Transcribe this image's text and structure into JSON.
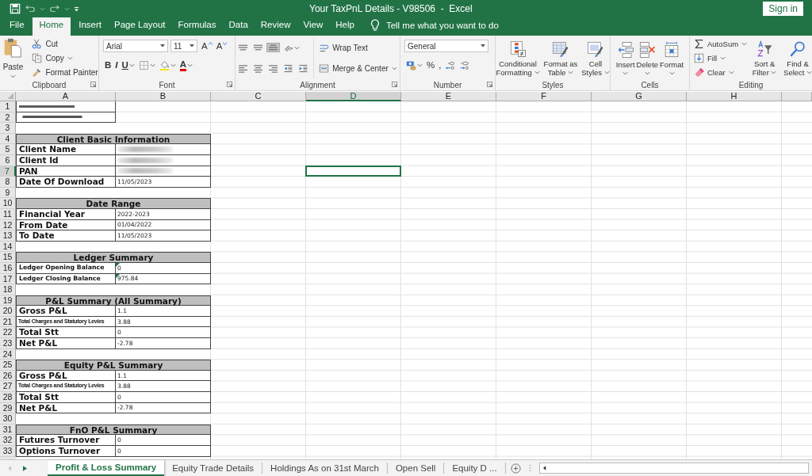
{
  "title_bar": {
    "title": "Your TaxPnL Details - V98506  -  Excel",
    "sign_in": "Sign in"
  },
  "menu_tabs": [
    {
      "label": "File",
      "selected": false
    },
    {
      "label": "Home",
      "selected": true
    },
    {
      "label": "Insert",
      "selected": false
    },
    {
      "label": "Page Layout",
      "selected": false
    },
    {
      "label": "Formulas",
      "selected": false
    },
    {
      "label": "Data",
      "selected": false
    },
    {
      "label": "Review",
      "selected": false
    },
    {
      "label": "View",
      "selected": false
    },
    {
      "label": "Help",
      "selected": false
    }
  ],
  "tell_me": "Tell me what you want to do",
  "ribbon": {
    "groups": [
      {
        "label": "Clipboard",
        "launcher": true,
        "sections": [
          [
            [
              {
                "kind": "large",
                "label": "Paste",
                "dropdown": true
              }
            ]
          ],
          [
            [
              {
                "kind": "small",
                "label": "Cut",
                "dropdown": false
              }
            ],
            [
              {
                "kind": "small",
                "label": "Copy",
                "dropdown": true
              }
            ],
            [
              {
                "kind": "small",
                "label": "Format Painter",
                "dropdown": false
              }
            ]
          ]
        ]
      },
      {
        "label": "Font",
        "launcher": true,
        "sections": [
          [
            [
              {
                "kind": "field",
                "value": "Arial"
              },
              {
                "kind": "size",
                "value": "11"
              },
              {
                "kind": "grow",
                "label": "A"
              },
              {
                "kind": "shrink",
                "label": "A"
              }
            ],
            [
              {
                "kind": "bold",
                "label": "B",
                "dropdown": false
              },
              {
                "kind": "italic",
                "label": "I",
                "dropdown": false
              },
              {
                "kind": "underline",
                "label": "U",
                "dropdown": true
              },
              {
                "kind": "icon",
                "dropdown": true
              },
              {
                "kind": "icon",
                "dropdown": true
              },
              {
                "kind": "fontcolor",
                "label": "A",
                "dropdown": true,
                "color": "#e00000"
              }
            ]
          ]
        ]
      },
      {
        "label": "Alignment",
        "launcher": true,
        "sections": [
          [
            [
              {
                "kind": "icon",
                "selected": false,
                "dropdown": false
              },
              {
                "kind": "icon",
                "selected": false,
                "dropdown": false
              },
              {
                "kind": "icon",
                "selected": true,
                "dropdown": false
              },
              {
                "kind": "icon",
                "selected": false,
                "dropdown": true
              }
            ],
            [
              {
                "kind": "icon",
                "dropdown": false
              },
              {
                "kind": "icon",
                "dropdown": false
              },
              {
                "kind": "icon",
                "dropdown": false
              },
              {
                "kind": "icon",
                "dropdown": false
              },
              {
                "kind": "icon",
                "dropdown": false
              }
            ]
          ],
          [
            [
              {
                "kind": "small",
                "label": "Wrap Text",
                "dropdown": false
              }
            ],
            [
              {
                "kind": "small",
                "label": "Merge & Center",
                "dropdown": true
              }
            ]
          ]
        ]
      },
      {
        "label": "Number",
        "launcher": true,
        "sections": [
          [
            [
              {
                "kind": "field",
                "value": "General"
              }
            ],
            [
              {
                "kind": "icon",
                "dropdown": true
              },
              {
                "kind": "percent",
                "label": "%",
                "dropdown": false
              },
              {
                "kind": "comma",
                "label": ",",
                "dropdown": false
              },
              {
                "kind": "icon",
                "dropdown": false
              },
              {
                "kind": "icon",
                "dropdown": false
              }
            ]
          ]
        ]
      },
      {
        "label": "Styles",
        "launcher": false,
        "sections": [
          [
            [
              {
                "kind": "large",
                "label": "Conditional Formatting",
                "dropdown": true
              }
            ]
          ],
          [
            [
              {
                "kind": "large",
                "label": "Format as Table",
                "dropdown": true
              }
            ]
          ],
          [
            [
              {
                "kind": "large",
                "label": "Cell Styles",
                "dropdown": true
              }
            ]
          ]
        ]
      },
      {
        "label": "Cells",
        "launcher": false,
        "sections": [
          [
            [
              {
                "kind": "large",
                "label": "Insert",
                "dropdown": true
              }
            ]
          ],
          [
            [
              {
                "kind": "large",
                "label": "Delete",
                "dropdown": true
              }
            ]
          ],
          [
            [
              {
                "kind": "large",
                "label": "Format",
                "dropdown": true
              }
            ]
          ]
        ]
      },
      {
        "label": "Editing",
        "launcher": false,
        "sections": [
          [
            [
              {
                "kind": "small",
                "label": "AutoSum",
                "dropdown": true
              }
            ],
            [
              {
                "kind": "small",
                "label": "Fill",
                "dropdown": true
              }
            ],
            [
              {
                "kind": "small",
                "label": "Clear",
                "dropdown": true
              }
            ]
          ],
          [
            [
              {
                "kind": "large",
                "label": "Sort & Filter",
                "dropdown": true
              }
            ]
          ],
          [
            [
              {
                "kind": "large",
                "label": "Find & Select",
                "dropdown": true
              }
            ]
          ]
        ]
      }
    ]
  },
  "sheet": {
    "columns": [
      {
        "label": "A",
        "selected": false
      },
      {
        "label": "B",
        "selected": false
      },
      {
        "label": "C",
        "selected": false
      },
      {
        "label": "D",
        "selected": true
      },
      {
        "label": "E",
        "selected": false
      },
      {
        "label": "F",
        "selected": false
      },
      {
        "label": "G",
        "selected": false
      },
      {
        "label": "H",
        "selected": false
      }
    ],
    "rows": [
      {
        "number": "1",
        "selected": false,
        "kind": "note"
      },
      {
        "number": "2",
        "selected": false,
        "kind": "note"
      },
      {
        "number": "3",
        "selected": false,
        "kind": "blank"
      },
      {
        "number": "4",
        "selected": false,
        "kind": "header",
        "label": "Client Basic Information"
      },
      {
        "number": "5",
        "selected": false,
        "kind": "field",
        "label": "Client Name",
        "redacted": true,
        "flagged": false
      },
      {
        "number": "6",
        "selected": false,
        "kind": "field",
        "label": "Client Id",
        "redacted": true,
        "flagged": false
      },
      {
        "number": "7",
        "selected": true,
        "kind": "field",
        "label": "PAN",
        "redacted": true,
        "flagged": false
      },
      {
        "number": "8",
        "selected": false,
        "kind": "field",
        "label": "Date Of Download",
        "value": "11/05/2023",
        "redacted": false,
        "flagged": false
      },
      {
        "number": "9",
        "selected": false,
        "kind": "blank"
      },
      {
        "number": "10",
        "selected": false,
        "kind": "header",
        "label": "Date Range"
      },
      {
        "number": "11",
        "selected": false,
        "kind": "field",
        "label": "Financial Year",
        "value": "2022-2023",
        "redacted": false,
        "flagged": false
      },
      {
        "number": "12",
        "selected": false,
        "kind": "field",
        "label": "From Date",
        "value": "01/04/2022",
        "redacted": false,
        "flagged": false
      },
      {
        "number": "13",
        "selected": false,
        "kind": "field",
        "label": "To Date",
        "value": "11/05/2023",
        "redacted": false,
        "flagged": false
      },
      {
        "number": "14",
        "selected": false,
        "kind": "blank"
      },
      {
        "number": "15",
        "selected": false,
        "kind": "header",
        "label": "Ledger Summary"
      },
      {
        "number": "16",
        "selected": false,
        "kind": "compact",
        "label": "Ledger Opening Balance",
        "value": "0",
        "redacted": false,
        "flagged": true
      },
      {
        "number": "17",
        "selected": false,
        "kind": "compact",
        "label": "Ledger Closing Balance",
        "value": "975.84",
        "redacted": false,
        "flagged": true
      },
      {
        "number": "18",
        "selected": false,
        "kind": "blank"
      },
      {
        "number": "19",
        "selected": false,
        "kind": "header",
        "label": "P&L Summary (All Summary)"
      },
      {
        "number": "20",
        "selected": false,
        "kind": "field",
        "label": "Gross P&L",
        "value": "1.1",
        "redacted": false,
        "flagged": false
      },
      {
        "number": "21",
        "selected": false,
        "kind": "tiny",
        "label": "Total Charges and Statutory Levies",
        "value": "3.88",
        "redacted": false,
        "flagged": false
      },
      {
        "number": "22",
        "selected": false,
        "kind": "field",
        "label": "Total Stt",
        "value": "0",
        "redacted": false,
        "flagged": false
      },
      {
        "number": "23",
        "selected": false,
        "kind": "field",
        "label": "Net P&L",
        "value": "-2.78",
        "redacted": false,
        "flagged": false
      },
      {
        "number": "24",
        "selected": false,
        "kind": "blank"
      },
      {
        "number": "25",
        "selected": false,
        "kind": "header",
        "label": "Equity P&L Summary"
      },
      {
        "number": "26",
        "selected": false,
        "kind": "field",
        "label": "Gross P&L",
        "value": "1.1",
        "redacted": false,
        "flagged": false
      },
      {
        "number": "27",
        "selected": false,
        "kind": "tiny",
        "label": "Total Charges and Statutory Levies",
        "value": "3.88",
        "redacted": false,
        "flagged": false
      },
      {
        "number": "28",
        "selected": false,
        "kind": "field",
        "label": "Total Stt",
        "value": "0",
        "redacted": false,
        "flagged": false
      },
      {
        "number": "29",
        "selected": false,
        "kind": "field",
        "label": "Net P&L",
        "value": "-2.78",
        "redacted": false,
        "flagged": false
      },
      {
        "number": "30",
        "selected": false,
        "kind": "blank"
      },
      {
        "number": "31",
        "selected": false,
        "kind": "header",
        "label": "FnO P&L Summary"
      },
      {
        "number": "32",
        "selected": false,
        "kind": "field",
        "label": "Futures Turnover",
        "value": "0",
        "redacted": false,
        "flagged": false
      },
      {
        "number": "33",
        "selected": false,
        "kind": "field",
        "label": "Options Turnover",
        "value": "0",
        "redacted": false,
        "flagged": false
      }
    ]
  },
  "sheet_tabs": [
    {
      "label": "Profit & Loss Summary",
      "selected": true
    },
    {
      "label": "Equity Trade Details",
      "selected": false
    },
    {
      "label": "Holdings As on 31st March",
      "selected": false
    },
    {
      "label": "Open Sell",
      "selected": false
    },
    {
      "label": "Equity D ...",
      "selected": false
    }
  ]
}
